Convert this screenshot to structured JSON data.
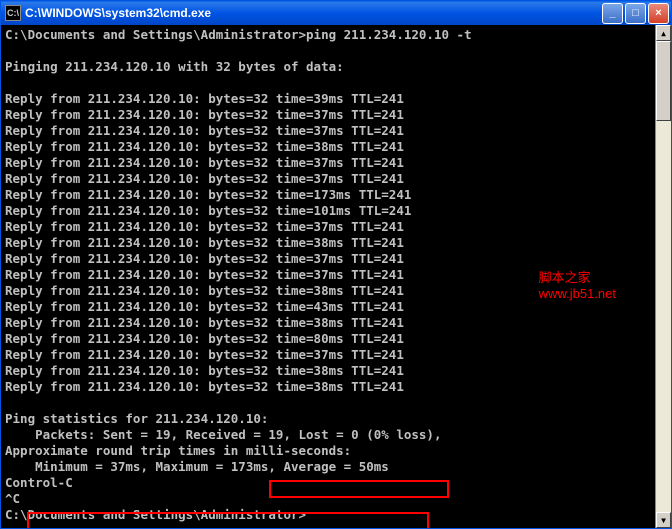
{
  "window": {
    "title": "C:\\WINDOWS\\system32\\cmd.exe",
    "icon_glyph": "C:\\"
  },
  "titlebar_buttons": {
    "min": "_",
    "max": "□",
    "close": "×"
  },
  "scrollbar": {
    "up": "▲",
    "down": "▼"
  },
  "prompt": {
    "line": "C:\\Documents and Settings\\Administrator>ping 211.234.120.10 -t"
  },
  "pinging_header": "Pinging 211.234.120.10 with 32 bytes of data:",
  "replies": [
    "Reply from 211.234.120.10: bytes=32 time=39ms TTL=241",
    "Reply from 211.234.120.10: bytes=32 time=37ms TTL=241",
    "Reply from 211.234.120.10: bytes=32 time=37ms TTL=241",
    "Reply from 211.234.120.10: bytes=32 time=38ms TTL=241",
    "Reply from 211.234.120.10: bytes=32 time=37ms TTL=241",
    "Reply from 211.234.120.10: bytes=32 time=37ms TTL=241",
    "Reply from 211.234.120.10: bytes=32 time=173ms TTL=241",
    "Reply from 211.234.120.10: bytes=32 time=101ms TTL=241",
    "Reply from 211.234.120.10: bytes=32 time=37ms TTL=241",
    "Reply from 211.234.120.10: bytes=32 time=38ms TTL=241",
    "Reply from 211.234.120.10: bytes=32 time=37ms TTL=241",
    "Reply from 211.234.120.10: bytes=32 time=37ms TTL=241",
    "Reply from 211.234.120.10: bytes=32 time=38ms TTL=241",
    "Reply from 211.234.120.10: bytes=32 time=43ms TTL=241",
    "Reply from 211.234.120.10: bytes=32 time=38ms TTL=241",
    "Reply from 211.234.120.10: bytes=32 time=80ms TTL=241",
    "Reply from 211.234.120.10: bytes=32 time=37ms TTL=241",
    "Reply from 211.234.120.10: bytes=32 time=38ms TTL=241",
    "Reply from 211.234.120.10: bytes=32 time=38ms TTL=241"
  ],
  "stats": {
    "header": "Ping statistics for 211.234.120.10:",
    "packets": "    Packets: Sent = 19, Received = 19, Lost = 0 (0% loss),",
    "approx": "Approximate round trip times in milli-seconds:",
    "times": "    Minimum = 37ms, Maximum = 173ms, Average = 50ms"
  },
  "ctrlc": "Control-C",
  "caret": "^C",
  "prompt2": "C:\\Documents and Settings\\Administrator>",
  "watermark": {
    "line1": "脚本之家",
    "line2": "www.jb51.net"
  }
}
